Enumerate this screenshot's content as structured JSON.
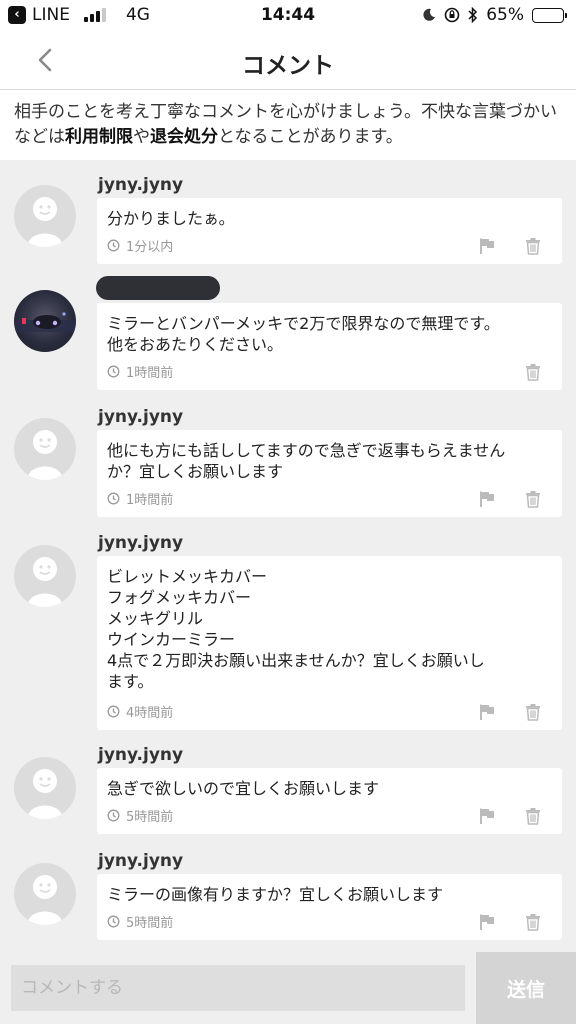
{
  "status": {
    "back_app": "LINE",
    "network": "4G",
    "time": "14:44",
    "battery": "65%",
    "battery_level": 0.65
  },
  "nav": {
    "title": "コメント",
    "back_icon": "chevron-left-icon"
  },
  "notice": {
    "text_1": "相手のことを考え丁寧なコメントを心がけましょう。不快な言葉づかいなどは",
    "em_1": "利用制限",
    "text_2": "や",
    "em_2": "退会処分",
    "text_3": "となることがあります。"
  },
  "comments": [
    {
      "user": "jyny.jyny",
      "redacted": false,
      "text": "分かりましたぁ。",
      "time": "1分以内",
      "report": true
    },
    {
      "user": "",
      "redacted": true,
      "text": "ミラーとバンパーメッキで2万で限界なので無理です。\n他をおあたりください。",
      "time": "1時間前",
      "report": false
    },
    {
      "user": "jyny.jyny",
      "redacted": false,
      "text": "他にも方にも話ししてますので急ぎで返事もらえません\nか？宜しくお願いします",
      "time": "1時間前",
      "report": true
    },
    {
      "user": "jyny.jyny",
      "redacted": false,
      "text": "ビレットメッキカバー\nフォグメッキカバー\nメッキグリル\nウインカーミラー\n4点で２万即決お願い出来ませんか？宜しくお願いし\nます。",
      "time": "4時間前",
      "report": true
    },
    {
      "user": "jyny.jyny",
      "redacted": false,
      "text": "急ぎで欲しいので宜しくお願いします",
      "time": "5時間前",
      "report": true
    },
    {
      "user": "jyny.jyny",
      "redacted": false,
      "text": "ミラーの画像有りますか？宜しくお願いします",
      "time": "5時間前",
      "report": true
    }
  ],
  "input": {
    "placeholder": "コメントする",
    "send_label": "送信"
  }
}
